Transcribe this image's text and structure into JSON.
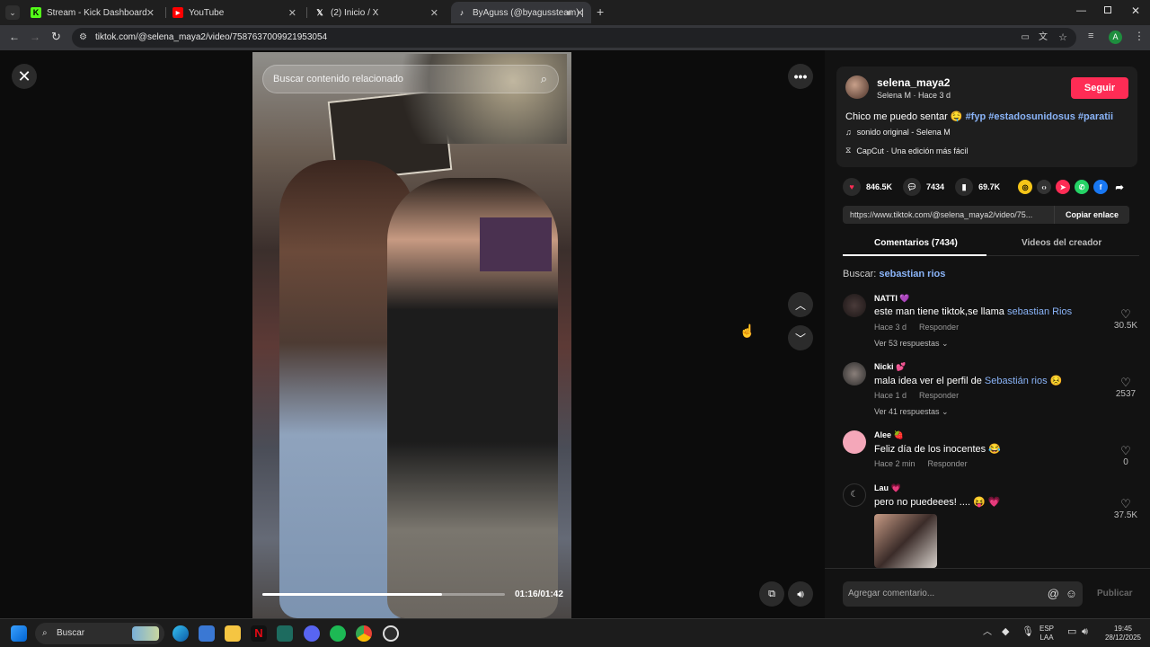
{
  "browser": {
    "tabs": [
      {
        "title": "Stream - Kick Dashboard",
        "favicon": "kick-icon",
        "color": "#53fc18"
      },
      {
        "title": "YouTube",
        "favicon": "youtube-icon",
        "color": "#ff0000"
      },
      {
        "title": "(2) Inicio / X",
        "favicon": "x-icon",
        "color": "#ffffff"
      },
      {
        "title": "ByAguss (@byagussteam) |",
        "favicon": "tiktok-icon",
        "color": "#ffffff"
      }
    ],
    "url": "tiktok.com/@selena_maya2/video/7587637009921953054",
    "profile_initial": "A"
  },
  "video": {
    "search_placeholder": "Buscar contenido relacionado",
    "time": "01:16/01:42",
    "progress": 0.74
  },
  "post": {
    "username": "selena_maya2",
    "subline": "Selena M · Hace 3 d",
    "follow_label": "Seguir",
    "caption_text": "Chico me puedo sentar 🤤",
    "hashtags": [
      "#fyp",
      "#estadosunidosus",
      "#paratii"
    ],
    "sound": "sonido original - Selena M",
    "capcut": "CapCut · Una edición más fácil",
    "likes": "846.5K",
    "comments": "7434",
    "saves": "69.7K",
    "link": "https://www.tiktok.com/@selena_maya2/video/75...",
    "copy_link_label": "Copiar enlace"
  },
  "tabs": {
    "comments": "Comentarios (7434)",
    "creator_videos": "Videos del creador"
  },
  "search": {
    "label": "Buscar:",
    "query": "sebastian rios"
  },
  "comments": [
    {
      "name": "NATTI 💜",
      "text": "este man tiene tiktok,se llama ",
      "highlight": "sebastian Rios",
      "time": "Hace 3 d",
      "reply": "Responder",
      "replies": "Ver 53 respuestas ⌄",
      "likes": "30.5K"
    },
    {
      "name": "Nicki 💕",
      "text": "mala idea ver el perfil de ",
      "highlight": "Sebastián rios",
      "suffix": " 😣",
      "time": "Hace 1 d",
      "reply": "Responder",
      "replies": "Ver 41 respuestas ⌄",
      "likes": "2537"
    },
    {
      "name": "Alee 🍓",
      "text": "Feliz día de los inocentes 😂",
      "time": "Hace 2 min",
      "reply": "Responder",
      "likes": "0"
    },
    {
      "name": "Lau 💗",
      "text": "pero no puedeees! .... 😝 💗",
      "likes": "37.5K"
    }
  ],
  "comment_box": {
    "placeholder": "Agregar comentario...",
    "publish": "Publicar"
  },
  "taskbar": {
    "search": "Buscar",
    "lang": "ESP",
    "lang2": "LAA",
    "time": "19:45",
    "date": "28/12/2025"
  }
}
